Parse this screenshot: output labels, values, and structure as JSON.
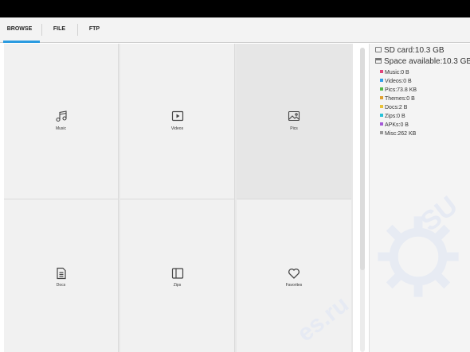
{
  "tabs": [
    "BROWSE",
    "FILE",
    "FTP"
  ],
  "categories": [
    {
      "label": "Music",
      "icon": "music-note-icon"
    },
    {
      "label": "Videos",
      "icon": "play-icon"
    },
    {
      "label": "Pics",
      "icon": "image-icon"
    },
    {
      "label": "Docs",
      "icon": "document-icon"
    },
    {
      "label": "Zips",
      "icon": "archive-icon"
    },
    {
      "label": "Favorites",
      "icon": "heart-icon"
    }
  ],
  "storage": {
    "sd_card": "SD card:10.3 GB",
    "space_available": "Space available:10.3 GB",
    "breakdown": [
      {
        "label": "Music:0 B",
        "color": "#e0457b"
      },
      {
        "label": "Videos:0 B",
        "color": "#2f9fe8"
      },
      {
        "label": "Pics:73.8 KB",
        "color": "#55b848"
      },
      {
        "label": "Themes:0 B",
        "color": "#e0a030"
      },
      {
        "label": "Docs:2 B",
        "color": "#e8c23a"
      },
      {
        "label": "Zips:0 B",
        "color": "#27c2d8"
      },
      {
        "label": "APKs:0 B",
        "color": "#a55ad8"
      },
      {
        "label": "Misc:262 KB",
        "color": "#9a9a9a"
      }
    ]
  }
}
